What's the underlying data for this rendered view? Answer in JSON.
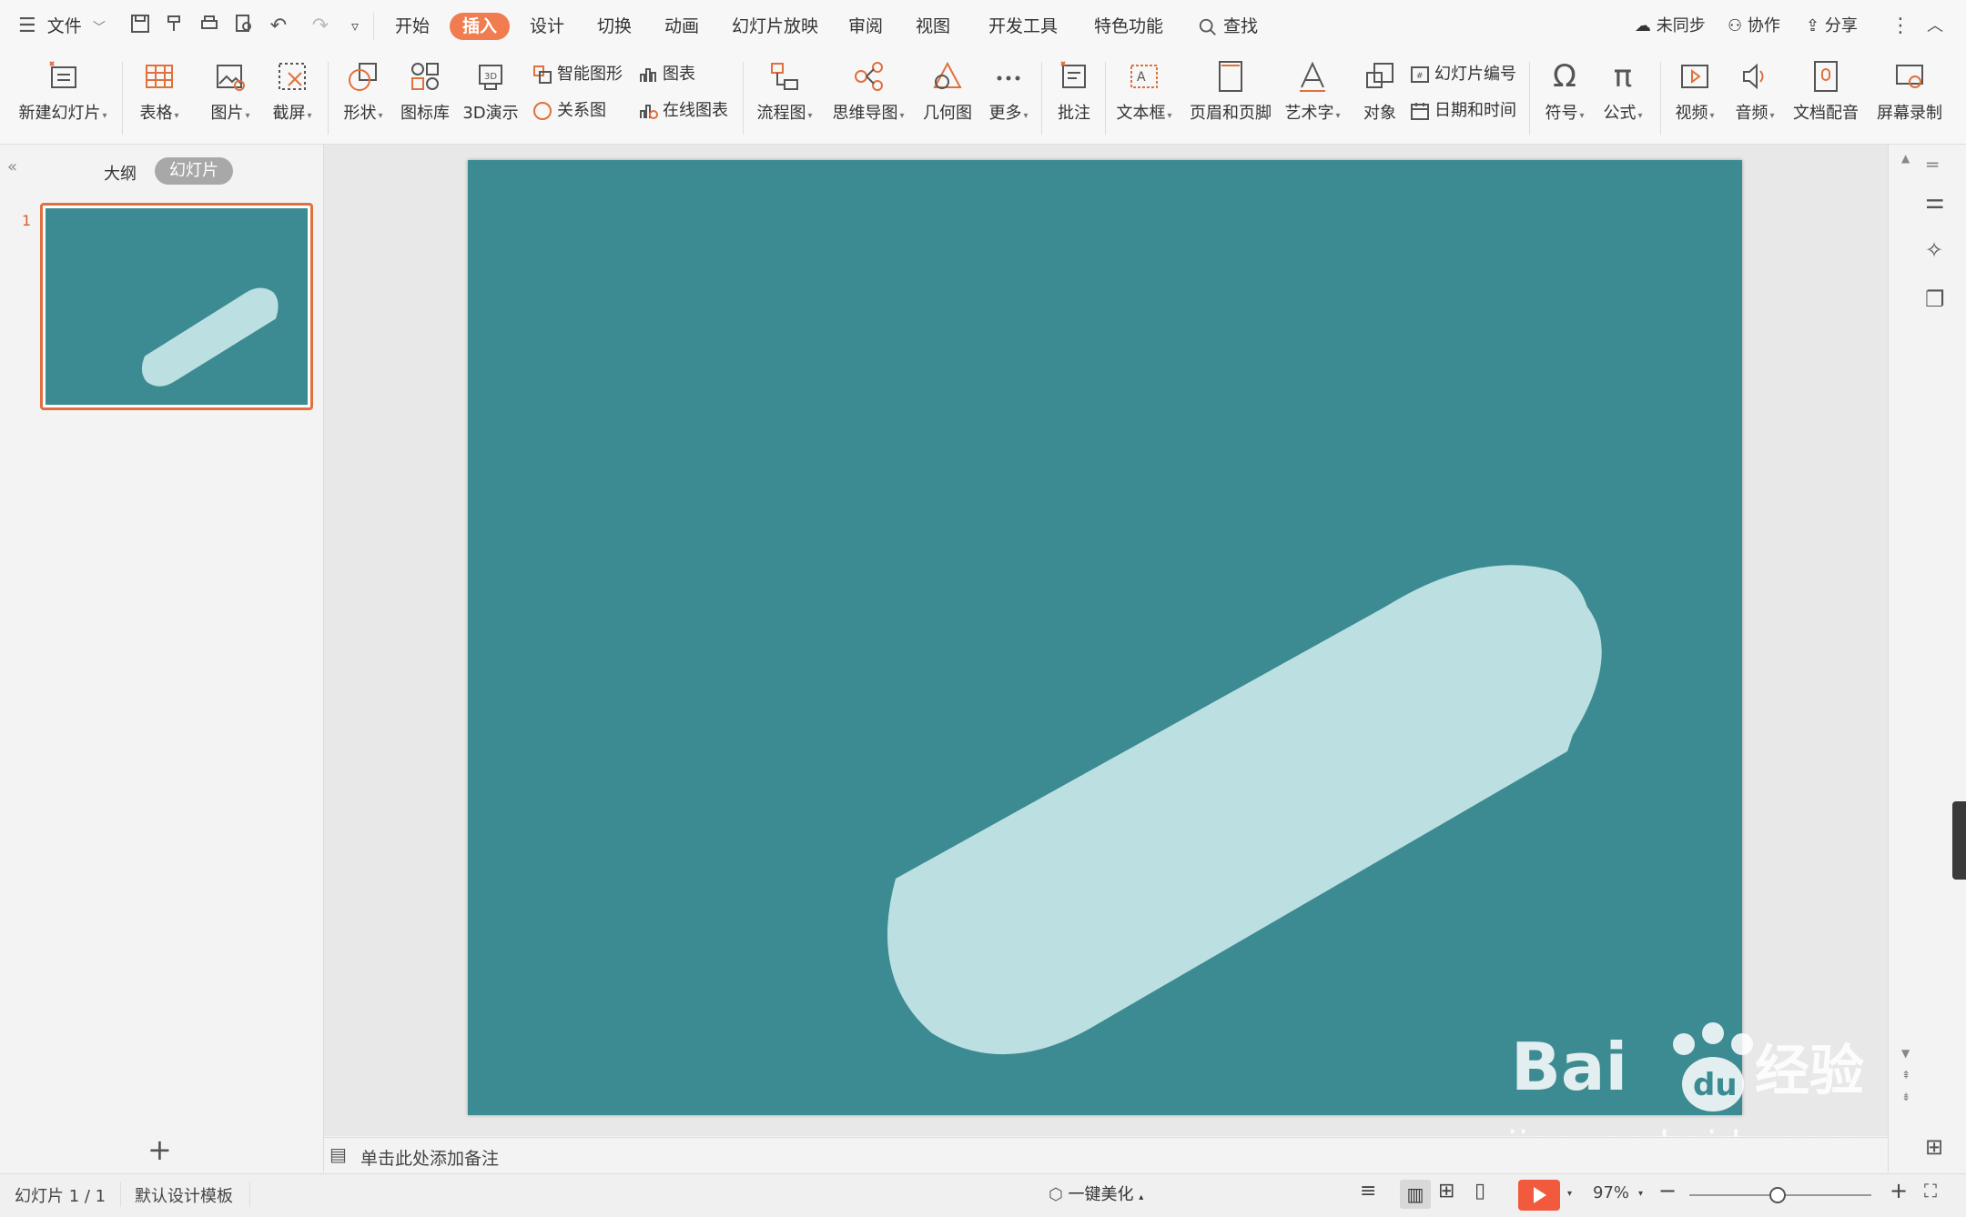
{
  "menubar": {
    "file_label": "文件",
    "tabs": [
      "开始",
      "插入",
      "设计",
      "切换",
      "动画",
      "幻灯片放映",
      "审阅",
      "视图",
      "开发工具",
      "特色功能"
    ],
    "active_tab": "插入",
    "search_label": "查找",
    "sync_label": "未同步",
    "collab_label": "协作",
    "share_label": "分享"
  },
  "ribbon": {
    "new_slide": "新建幻灯片",
    "table": "表格",
    "picture": "图片",
    "screenshot": "截屏",
    "shape": "形状",
    "icon_lib": "图标库",
    "demo3d": "3D演示",
    "smart_shape": "智能图形",
    "relation": "关系图",
    "chart": "图表",
    "online_chart": "在线图表",
    "flowchart": "流程图",
    "mindmap": "思维导图",
    "geometry": "几何图",
    "more": "更多",
    "comment": "批注",
    "textbox": "文本框",
    "header_footer": "页眉和页脚",
    "wordart": "艺术字",
    "object": "对象",
    "slide_number": "幻灯片编号",
    "datetime": "日期和时间",
    "symbol": "符号",
    "formula": "公式",
    "video": "视频",
    "audio": "音频",
    "doc_voice": "文档配音",
    "screen_record": "屏幕录制"
  },
  "leftpanel": {
    "tab_outline": "大纲",
    "tab_slides": "幻灯片",
    "slide_number": "1"
  },
  "notes": {
    "placeholder": "单击此处添加备注"
  },
  "statusbar": {
    "slide_info": "幻灯片 1 / 1",
    "template": "默认设计模板",
    "beautify": "一键美化",
    "zoom": "97%"
  },
  "watermark": {
    "brand": "Baidu经验",
    "url": "jingyan.baidu.com"
  },
  "colors": {
    "accent": "#f07c4f",
    "slide_bg": "#3d8b92",
    "shape_fill": "#bce0e2"
  }
}
